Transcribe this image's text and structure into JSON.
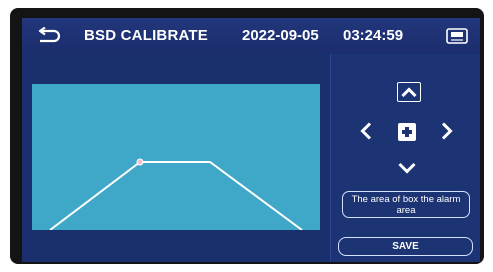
{
  "header": {
    "title": "BSD CALIBRATE",
    "date": "2022-09-05",
    "time": "03:24:59"
  },
  "icons": {
    "back": "back-arrow-icon",
    "storage": "sd-card-icon",
    "up": "chevron-up-icon",
    "left": "chevron-left-icon",
    "center": "center-point-icon",
    "right": "chevron-right-icon",
    "down": "chevron-down-icon"
  },
  "side_panel": {
    "info_text": "The area of box the alarm area",
    "save_label": "SAVE"
  },
  "colors": {
    "screen_bg": "#1a2f6e",
    "camera_view": "#3fa7c8",
    "outline": "#ffffff"
  }
}
